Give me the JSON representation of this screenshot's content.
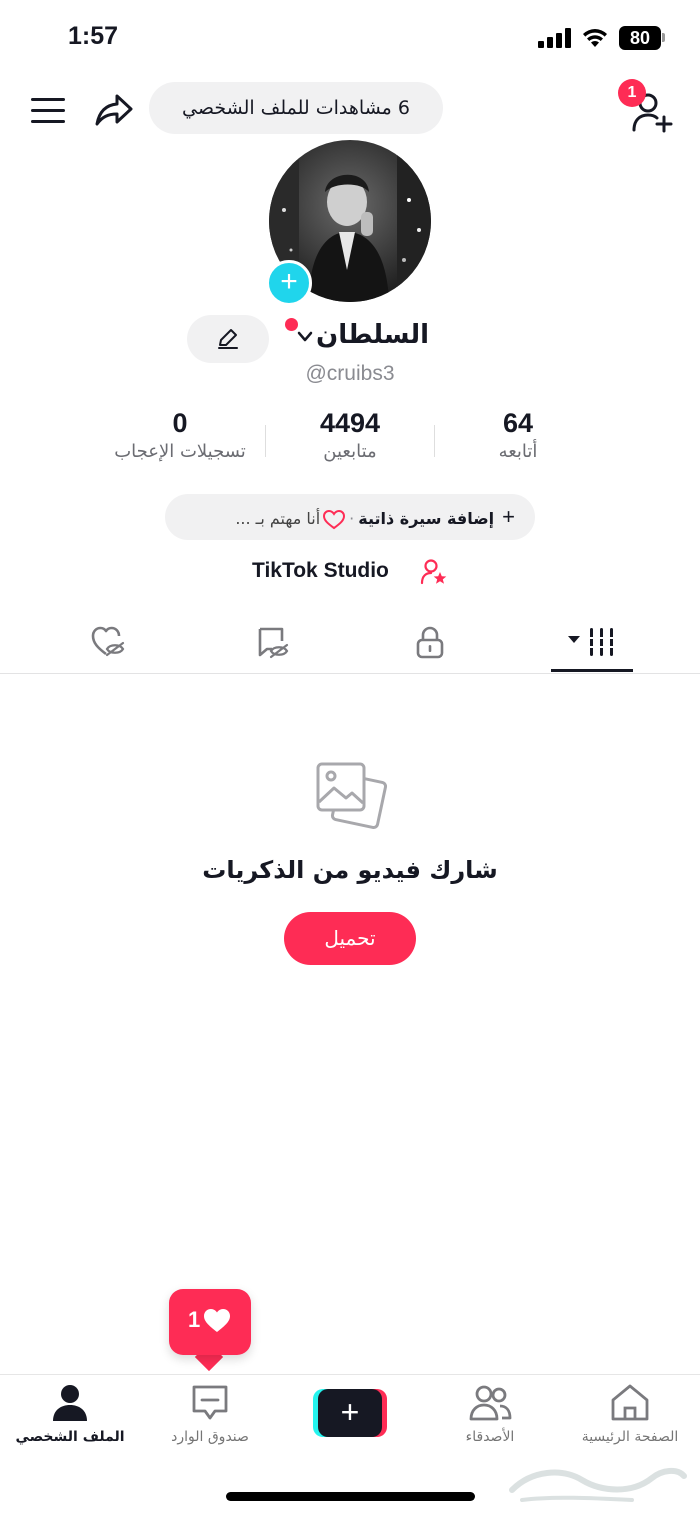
{
  "status_bar": {
    "time": "1:57",
    "battery": "80"
  },
  "header": {
    "profile_views": "6 مشاهدات للملف الشخصي",
    "friend_request_badge": "1",
    "menu_icon": "hamburger-menu-icon",
    "share_icon": "share-arrow-icon",
    "add_friend_icon": "add-person-icon"
  },
  "profile": {
    "display_name": "السلطان",
    "username": "@cruibs3",
    "avatar_add_label": "+"
  },
  "stats": [
    {
      "value": "64",
      "label": "أتابعه"
    },
    {
      "value": "4494",
      "label": "متابعين"
    },
    {
      "value": "0",
      "label": "تسجيلات الإعجاب"
    }
  ],
  "bio": {
    "plus": "+",
    "add_bio": "إضافة سيرة ذاتية",
    "separator": "·",
    "interests": "أنا مهتم بـ ..."
  },
  "studio": {
    "label": "TikTok Studio"
  },
  "tabs": [
    {
      "icon": "grid-videos-icon",
      "active": true
    },
    {
      "icon": "lock-icon",
      "active": false
    },
    {
      "icon": "hidden-repost-icon",
      "active": false
    },
    {
      "icon": "hidden-likes-icon",
      "active": false
    }
  ],
  "empty_state": {
    "title": "شارك فيديو من الذكريات",
    "upload_label": "تحميل"
  },
  "likes_notification": {
    "count": "1"
  },
  "bottom_nav": [
    {
      "label": "الصفحة الرئيسية",
      "icon": "home-icon",
      "active": false
    },
    {
      "label": "الأصدقاء",
      "icon": "friends-icon",
      "active": false
    },
    {
      "label": "",
      "icon": "create-plus-icon",
      "active": false
    },
    {
      "label": "صندوق الوارد",
      "icon": "inbox-icon",
      "active": false
    },
    {
      "label": "الملف الشخصي",
      "icon": "profile-icon",
      "active": true
    }
  ],
  "colors": {
    "accent": "#fe2c55",
    "cyan": "#25f4ee",
    "avatar_add": "#20d5ec",
    "text": "#161823",
    "muted": "#8a8b91",
    "pill_bg": "#f1f1f2"
  }
}
